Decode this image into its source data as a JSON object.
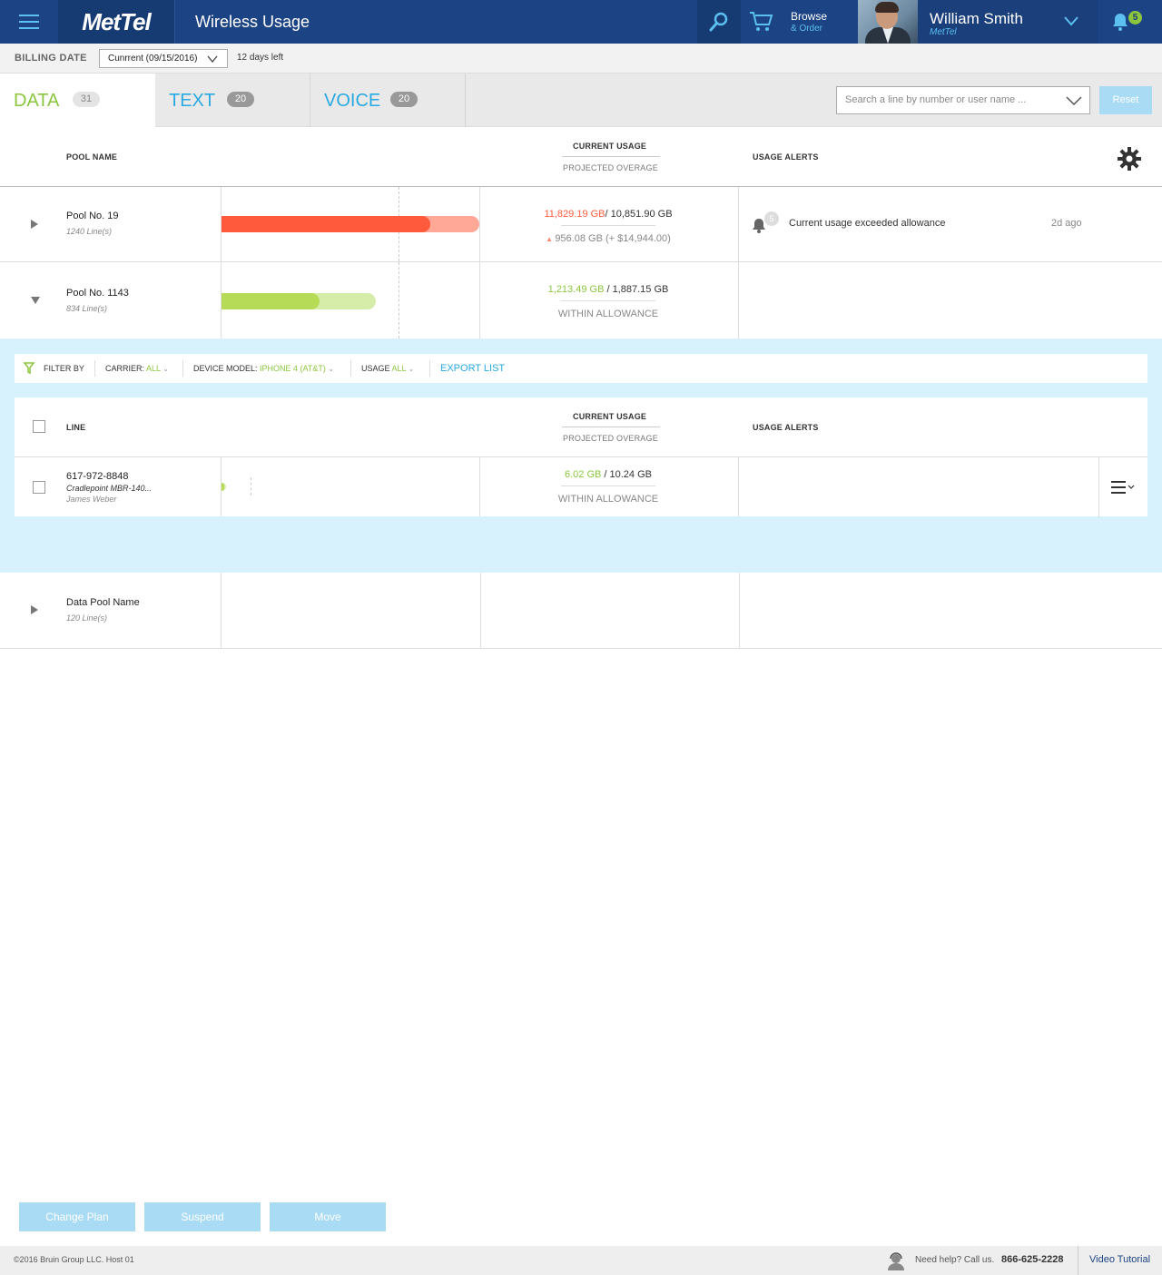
{
  "header": {
    "logo": "MetTel",
    "title": "Wireless Usage",
    "browse": "Browse",
    "browse_sub": "& Order",
    "user_name": "William Smith",
    "user_org": "MetTel",
    "notification_count": "5"
  },
  "billing": {
    "label": "BILLING DATE",
    "selected": "Cunrrent (09/15/2016)",
    "days_left": "12 days left"
  },
  "tabs": [
    {
      "label": "DATA",
      "count": "31"
    },
    {
      "label": "TEXT",
      "count": "20"
    },
    {
      "label": "VOICE",
      "count": "20"
    }
  ],
  "search": {
    "placeholder": "Search a line by number or user name ...",
    "reset": "Reset"
  },
  "columns": {
    "pool_name": "POOL NAME",
    "current_usage": "CURRENT USAGE",
    "projected_overage": "PROJECTED OVERAGE",
    "usage_alerts": "USAGE ALERTS",
    "line": "LINE"
  },
  "pools": [
    {
      "name": "Pool No. 19",
      "lines": "1240 Line(s)",
      "used": "11,829.19 GB",
      "allowance": "/ 10,851.90 GB",
      "overage": "956.08 GB (+ $14,944.00)",
      "usage_fraction": 0.81,
      "projected_fraction": 1.0,
      "alert_text": "Current usage exceeded allowance",
      "alert_count": "5",
      "alert_time": "2d ago"
    },
    {
      "name": "Pool No. 1143",
      "lines": "834 Line(s)",
      "used": "1,213.49 GB",
      "allowance": " / 1,887.15 GB",
      "status": "WITHIN ALLOWANCE",
      "usage_fraction": 0.38,
      "projected_fraction": 0.6
    },
    {
      "name": "Data Pool Name",
      "lines": "120 Line(s)"
    }
  ],
  "filter": {
    "label": "FILTER BY",
    "carrier_label": "CARRIER:",
    "carrier_value": "ALL",
    "device_label": "DEVICE MODEL:",
    "device_value": "IPHONE 4 (AT&T)",
    "usage_label": "USAGE",
    "usage_value": "ALL",
    "export": "EXPORT LIST"
  },
  "line_rows": [
    {
      "number": "617-972-8848",
      "device": "Cradlepoint MBR-140...",
      "user": "James Weber",
      "used": "6.02 GB",
      "allowance": " / 10.24 GB",
      "status": "WITHIN ALLOWANCE",
      "usage_fraction": 0.06,
      "projected_fraction": 0.1
    }
  ],
  "actions": {
    "change_plan": "Change Plan",
    "suspend": "Suspend",
    "move": "Move"
  },
  "footer": {
    "copyright": "©2016 Bruin Group LLC. Host 01",
    "help": "Need help? Call us.",
    "phone": "866-625-2228",
    "video": "Video Tutorial"
  },
  "colors": {
    "brand_blue": "#1c4383",
    "accent_cyan": "#29a9e1",
    "ok_green": "#8cc63f",
    "over_red": "#ff5a3c"
  }
}
